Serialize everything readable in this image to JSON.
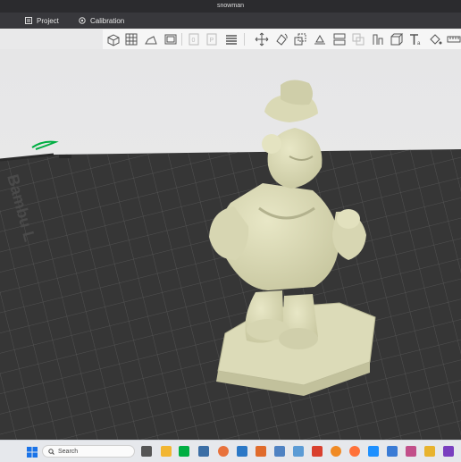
{
  "window": {
    "title": "snowman"
  },
  "tabs": [
    {
      "label": "Project",
      "icon": "project-icon"
    },
    {
      "label": "Calibration",
      "icon": "calibration-icon"
    }
  ],
  "toolbar": {
    "buttons": [
      "add-object-icon",
      "add-plate-icon",
      "auto-orient-icon",
      "arrange-icon",
      "plate-icon",
      "split-plate-icon",
      "layers-icon",
      "move-icon",
      "rotate-icon",
      "scale-icon",
      "lay-on-face-icon",
      "cut-icon",
      "mesh-boolean-icon",
      "support-paint-icon",
      "seam-paint-icon",
      "cube-view-icon",
      "text-icon",
      "color-paint-icon",
      "measure-icon"
    ]
  },
  "plate": {
    "brand_text": "Bambu L"
  },
  "taskbar": {
    "search_placeholder": "Search",
    "apps": [
      "start-icon",
      "task-view-icon",
      "file-explorer-icon",
      "bambu-studio-icon",
      "terminal-icon",
      "browser-icon",
      "mail-icon",
      "store-icon",
      "settings-icon",
      "photos-icon",
      "office-icon",
      "blender-icon",
      "firefox-icon",
      "vscode-icon",
      "cura-icon",
      "app-icon"
    ]
  },
  "colors": {
    "accent": "#00ae42",
    "model": "#d9d8b4",
    "plate": "#363636",
    "grid": "#5a5a5a"
  }
}
